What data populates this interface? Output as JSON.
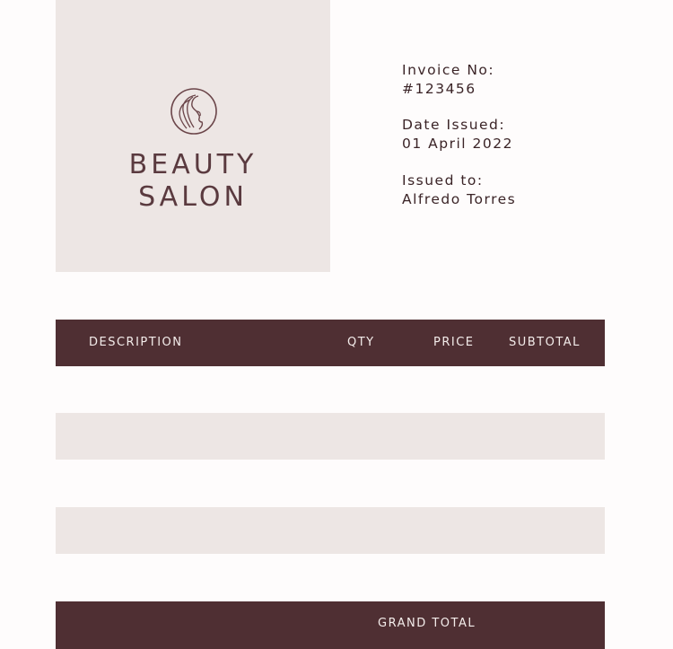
{
  "brand": {
    "line1": "BEAUTY",
    "line2": "SALON",
    "logo_icon": "woman-profile-icon",
    "panel_color": "#ede6e4",
    "accent_color": "#4f2f33"
  },
  "invoice": {
    "number_label": "Invoice No:",
    "number_value": "#123456",
    "date_label": "Date Issued:",
    "date_value": "01 April 2022",
    "issued_to_label": "Issued to:",
    "issued_to_value": "Alfredo Torres"
  },
  "table": {
    "headers": [
      "DESCRIPTION",
      "QTY",
      "PRICE",
      "SUBTOTAL"
    ],
    "rows": [
      {
        "description": "",
        "qty": "",
        "price": "",
        "subtotal": ""
      },
      {
        "description": "",
        "qty": "",
        "price": "",
        "subtotal": ""
      },
      {
        "description": "",
        "qty": "",
        "price": "",
        "subtotal": ""
      },
      {
        "description": "",
        "qty": "",
        "price": "",
        "subtotal": ""
      },
      {
        "description": "",
        "qty": "",
        "price": "",
        "subtotal": ""
      }
    ]
  },
  "totals": {
    "grand_total_label": "GRAND TOTAL"
  }
}
